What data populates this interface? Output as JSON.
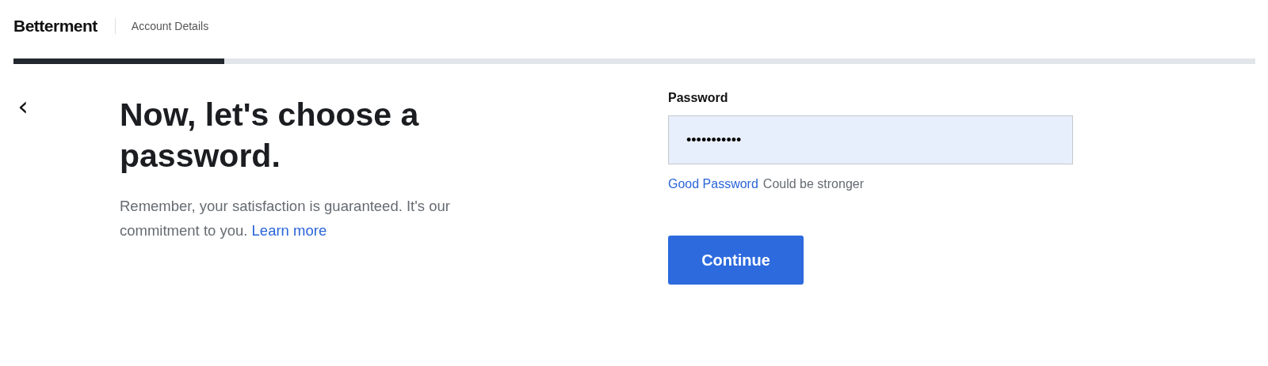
{
  "header": {
    "logo": "Betterment",
    "section": "Account Details"
  },
  "progress": {
    "level": 0.17
  },
  "back": {
    "label": "‹"
  },
  "intro": {
    "title": "Now, let's choose a password.",
    "body": "Remember, your satisfaction is guaranteed. It's our commitment to you.",
    "link": "Learn more"
  },
  "form": {
    "label": "Password",
    "value": "•••••••••••",
    "strength": "Good Password",
    "strength_hint": "Could be stronger",
    "button": "Continue"
  }
}
